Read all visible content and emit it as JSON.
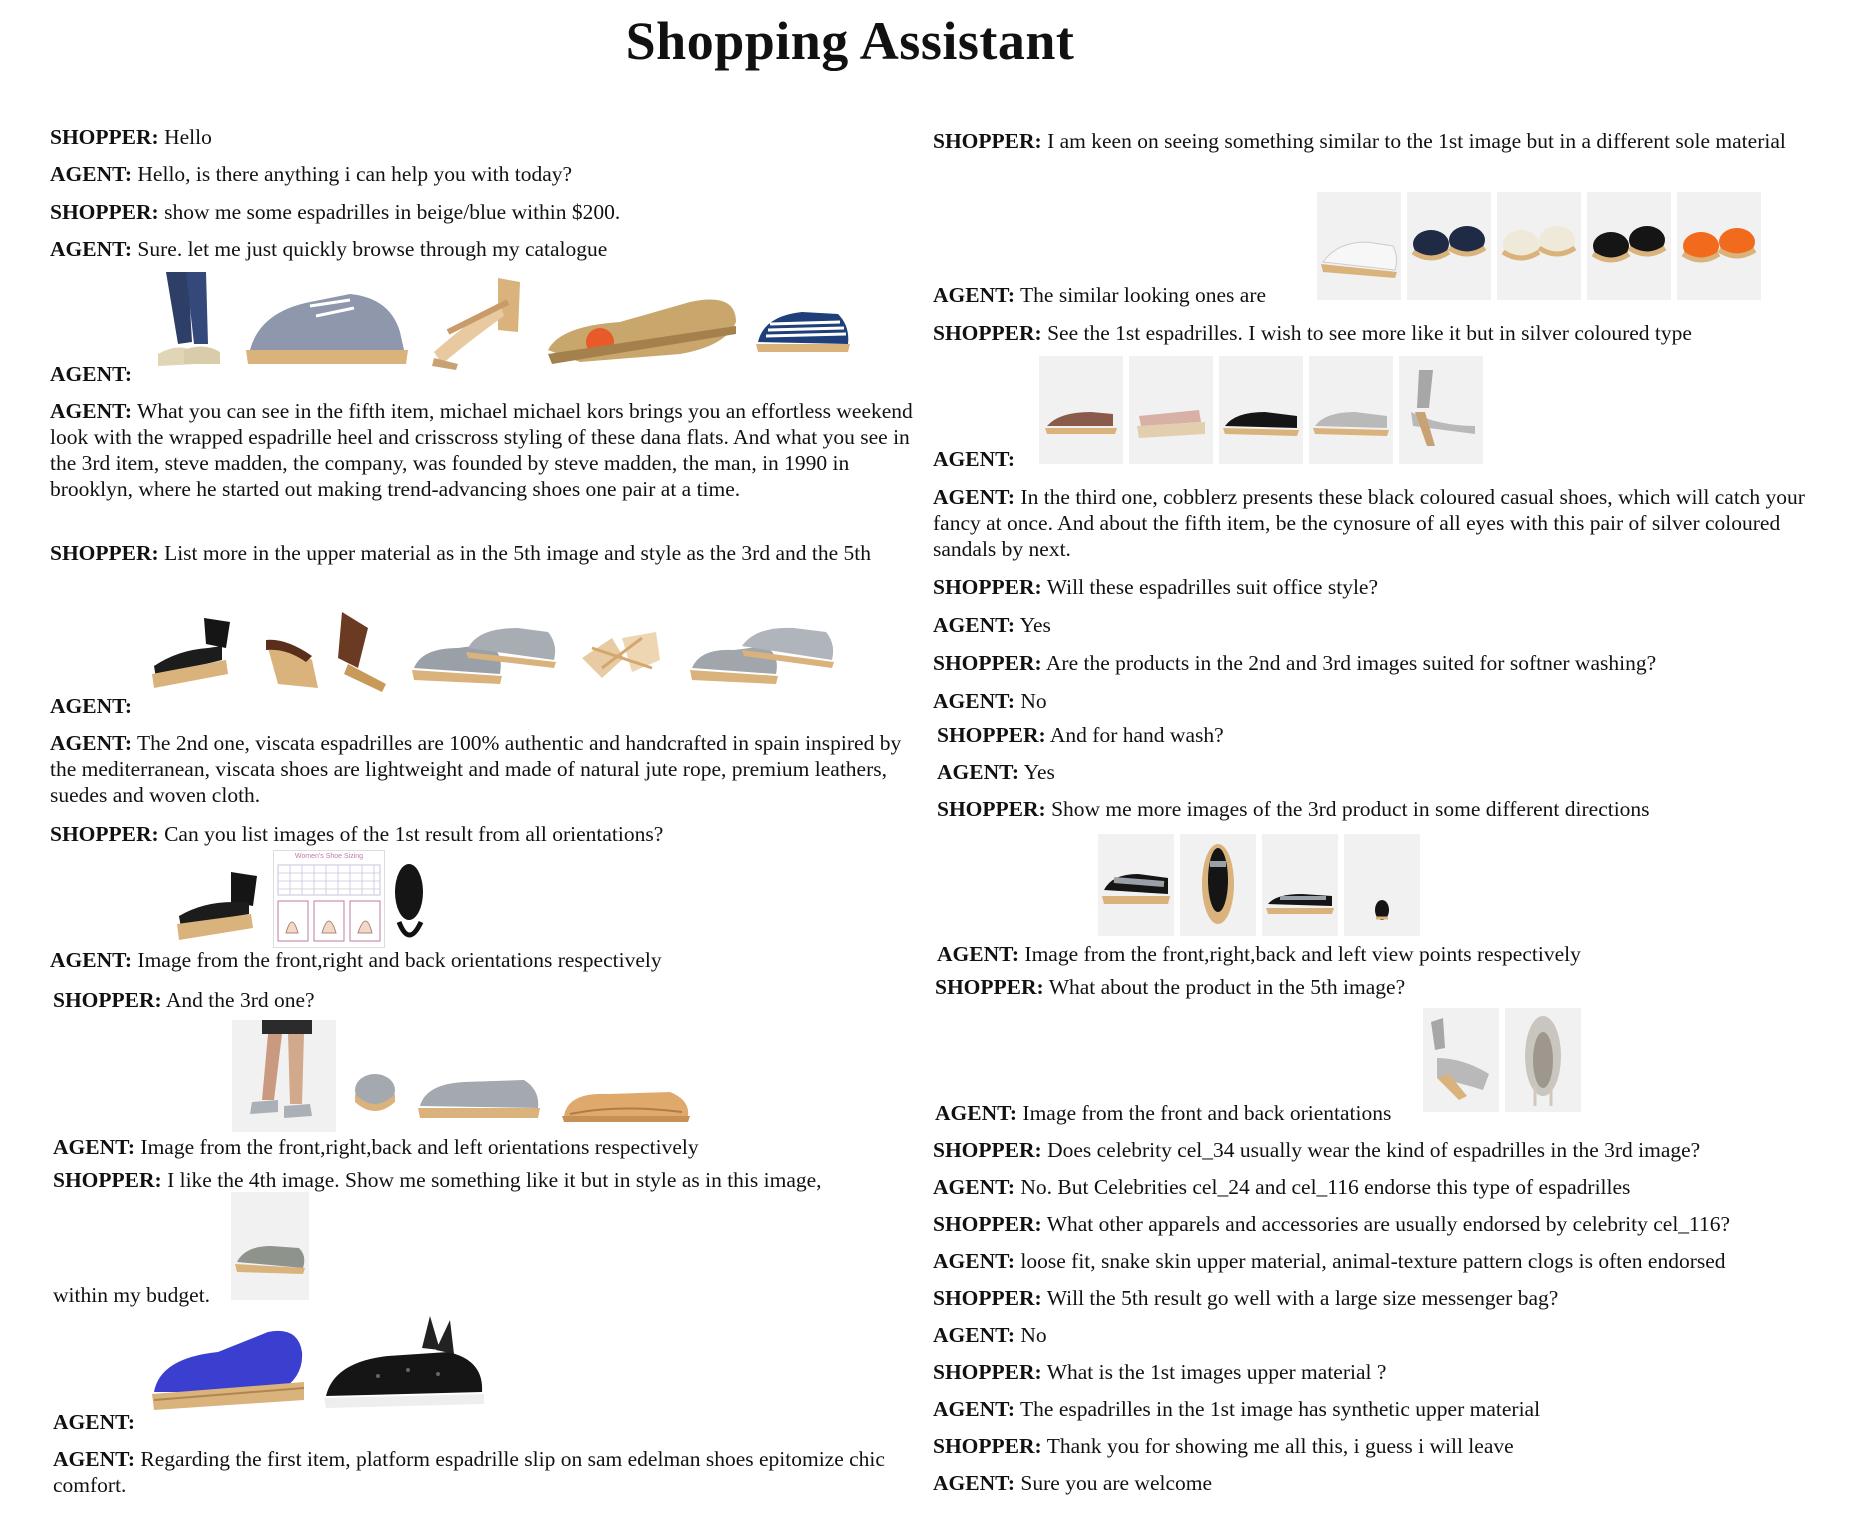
{
  "title": "Shopping Assistant",
  "labels": {
    "shopper": "SHOPPER:",
    "agent": "AGENT:"
  },
  "left": {
    "l1": "Hello",
    "l2": "Hello, is there anything i can help you with today?",
    "l3": "show me some espadrilles in beige/blue within $200.",
    "l4": "Sure. let me just quickly browse through my catalogue",
    "l6": "What you can see in the fifth item, michael michael kors brings you an effortless weekend look with the wrapped espadrille heel and crisscross styling of these dana flats. And what you see in the 3rd item, steve madden, the company, was founded by steve madden, the man, in 1990 in brooklyn, where he started out making trend-advancing shoes one pair at a time.",
    "l7": "List more in the upper material as in the 5th image and style as the 3rd and the 5th",
    "l9": "The 2nd one, viscata espadrilles are 100% authentic and handcrafted in spain inspired by the mediterranean, viscata shoes are lightweight and made of natural jute rope, premium leathers, suedes and woven cloth.",
    "l10": "Can you list images of the 1st result from all orientations?",
    "size_chart_title": "Women's Shoe Sizing",
    "l11": "Image from the front,right and back orientations respectively",
    "l12": "And the 3rd one?",
    "l13": "Image from the front,right,back and left orientations respectively",
    "l14": "I like the 4th image. Show me something like it but in style as in this image,",
    "l14b": "within my budget.",
    "l16": "Regarding the first item, platform espadrille slip on sam edelman shoes epitomize chic comfort."
  },
  "right": {
    "r1": "I am keen on seeing something similar to the 1st image but in a different sole material",
    "r2": "The similar looking ones are",
    "r3": "See the 1st espadrilles. I wish to see more like it but in silver coloured type",
    "r5": "In the third one, cobblerz presents these black coloured casual shoes, which will catch your fancy at once. And about the fifth item, be the cynosure of all eyes with this pair of silver coloured sandals by next.",
    "r6": "Will these espadrilles suit office style?",
    "r7": "Yes",
    "r8": "Are the products in the 2nd and 3rd images suited for softner washing?",
    "r9": "No",
    "r10": "And for hand wash?",
    "r11": "Yes",
    "r12": "Show me more images of the 3rd product in some different directions",
    "r13": "Image from the front,right,back and left view points respectively",
    "r14": "What about the product in the 5th image?",
    "r15": "Image from the front and back orientations",
    "r16": "Does celebrity cel_34 usually wear the kind of espadrilles in the 3rd image?",
    "r17": "No. But Celebrities cel_24 and cel_116 endorse this type of espadrilles",
    "r18": "What other apparels and accessories are usually endorsed by celebrity cel_116?",
    "r19": "loose fit, snake skin upper material, animal-texture pattern clogs is often endorsed",
    "r20": "Will the 5th result go well with a large size messenger bag?",
    "r21": "No",
    "r22": "What is the 1st images upper material ?",
    "r23": "The espadrilles in the 1st image has synthetic upper material",
    "r24": "Thank you for showing me all this, i guess i will leave",
    "r25": "Sure you are welcome"
  },
  "colors": {
    "jute": "#d9b27c",
    "beige": "#e8d9bf",
    "grey": "#9aa0a8",
    "navy": "#1f2a44",
    "orange": "#f26a1b",
    "blue": "#3b3fd0",
    "black": "#151515",
    "silver": "#b9b9b9",
    "brown": "#6b3a22"
  }
}
